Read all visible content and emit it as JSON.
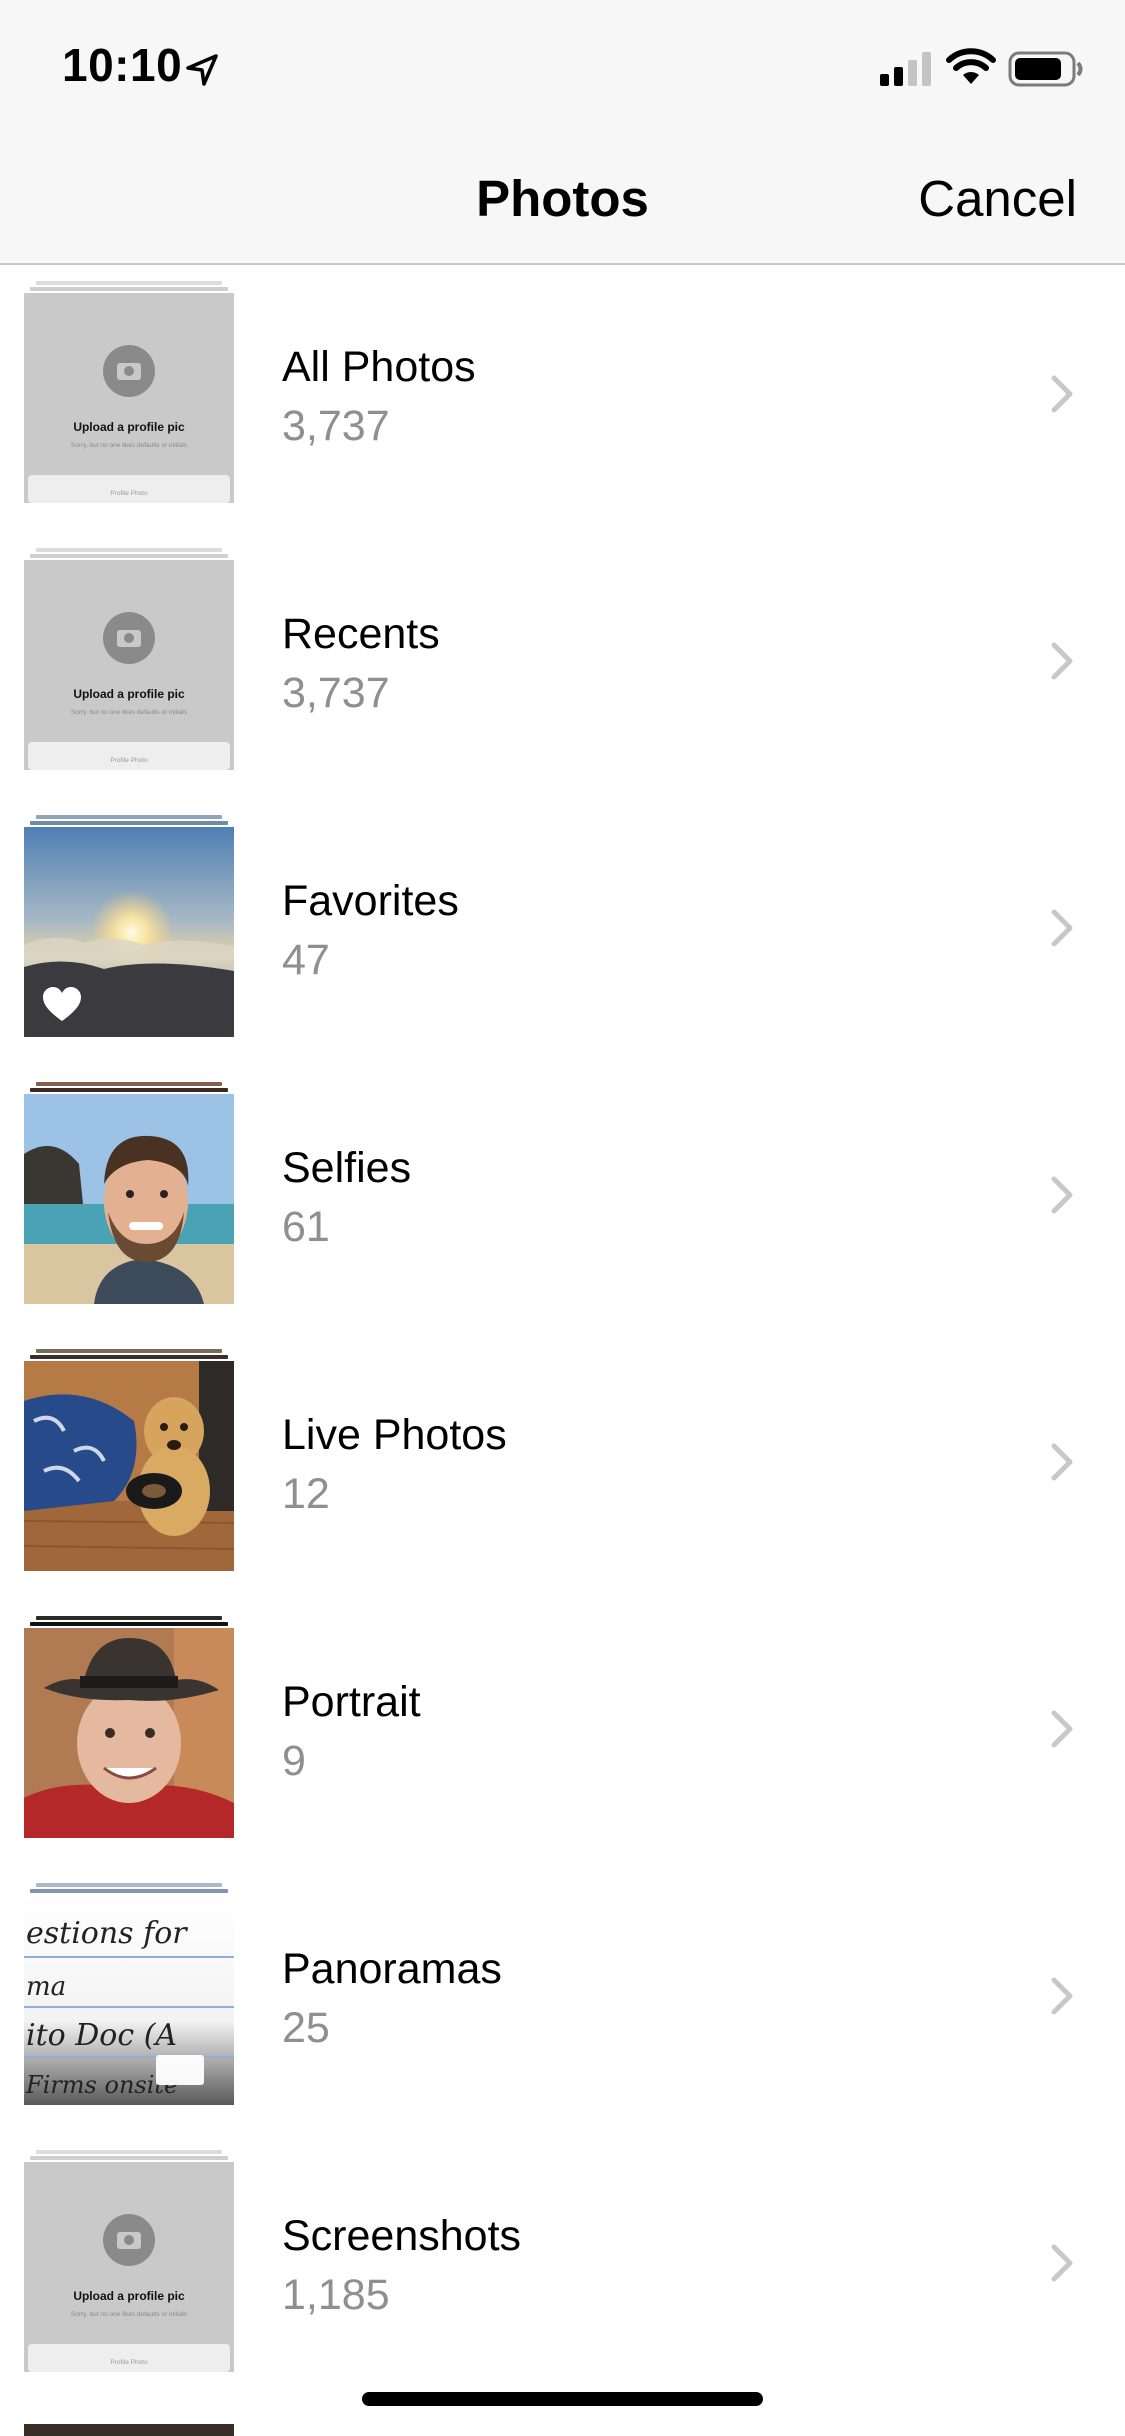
{
  "status_bar": {
    "time": "10:10"
  },
  "navbar": {
    "title": "Photos",
    "cancel_label": "Cancel"
  },
  "albums": [
    {
      "name": "All Photos",
      "count": "3,737",
      "thumb": "placeholder"
    },
    {
      "name": "Recents",
      "count": "3,737",
      "thumb": "placeholder"
    },
    {
      "name": "Favorites",
      "count": "47",
      "thumb": "sunset"
    },
    {
      "name": "Selfies",
      "count": "61",
      "thumb": "selfie"
    },
    {
      "name": "Live Photos",
      "count": "12",
      "thumb": "dog"
    },
    {
      "name": "Portrait",
      "count": "9",
      "thumb": "portrait"
    },
    {
      "name": "Panoramas",
      "count": "25",
      "thumb": "handwriting"
    },
    {
      "name": "Screenshots",
      "count": "1,185",
      "thumb": "placeholder"
    }
  ],
  "placeholder_thumb": {
    "title": "Upload a profile pic",
    "subtitle": "Sorry, but no one likes defaults or initials",
    "footer": "Profile Photo"
  },
  "handwriting_thumb": {
    "line1": "estions for",
    "line2": "ma",
    "line3": "ito Doc (A",
    "line4": "Firms onsite"
  },
  "colors": {
    "nav_background": "#f7f7f7",
    "secondary_text": "#8e8e93",
    "chevron": "#c7c7cc",
    "separator": "#c8c7cc"
  },
  "icons": {
    "status": [
      "location-arrow-icon",
      "cellular-signal-icon",
      "wifi-icon",
      "battery-icon"
    ],
    "row": "chevron-right-icon",
    "favorites_badge": "heart-icon"
  }
}
